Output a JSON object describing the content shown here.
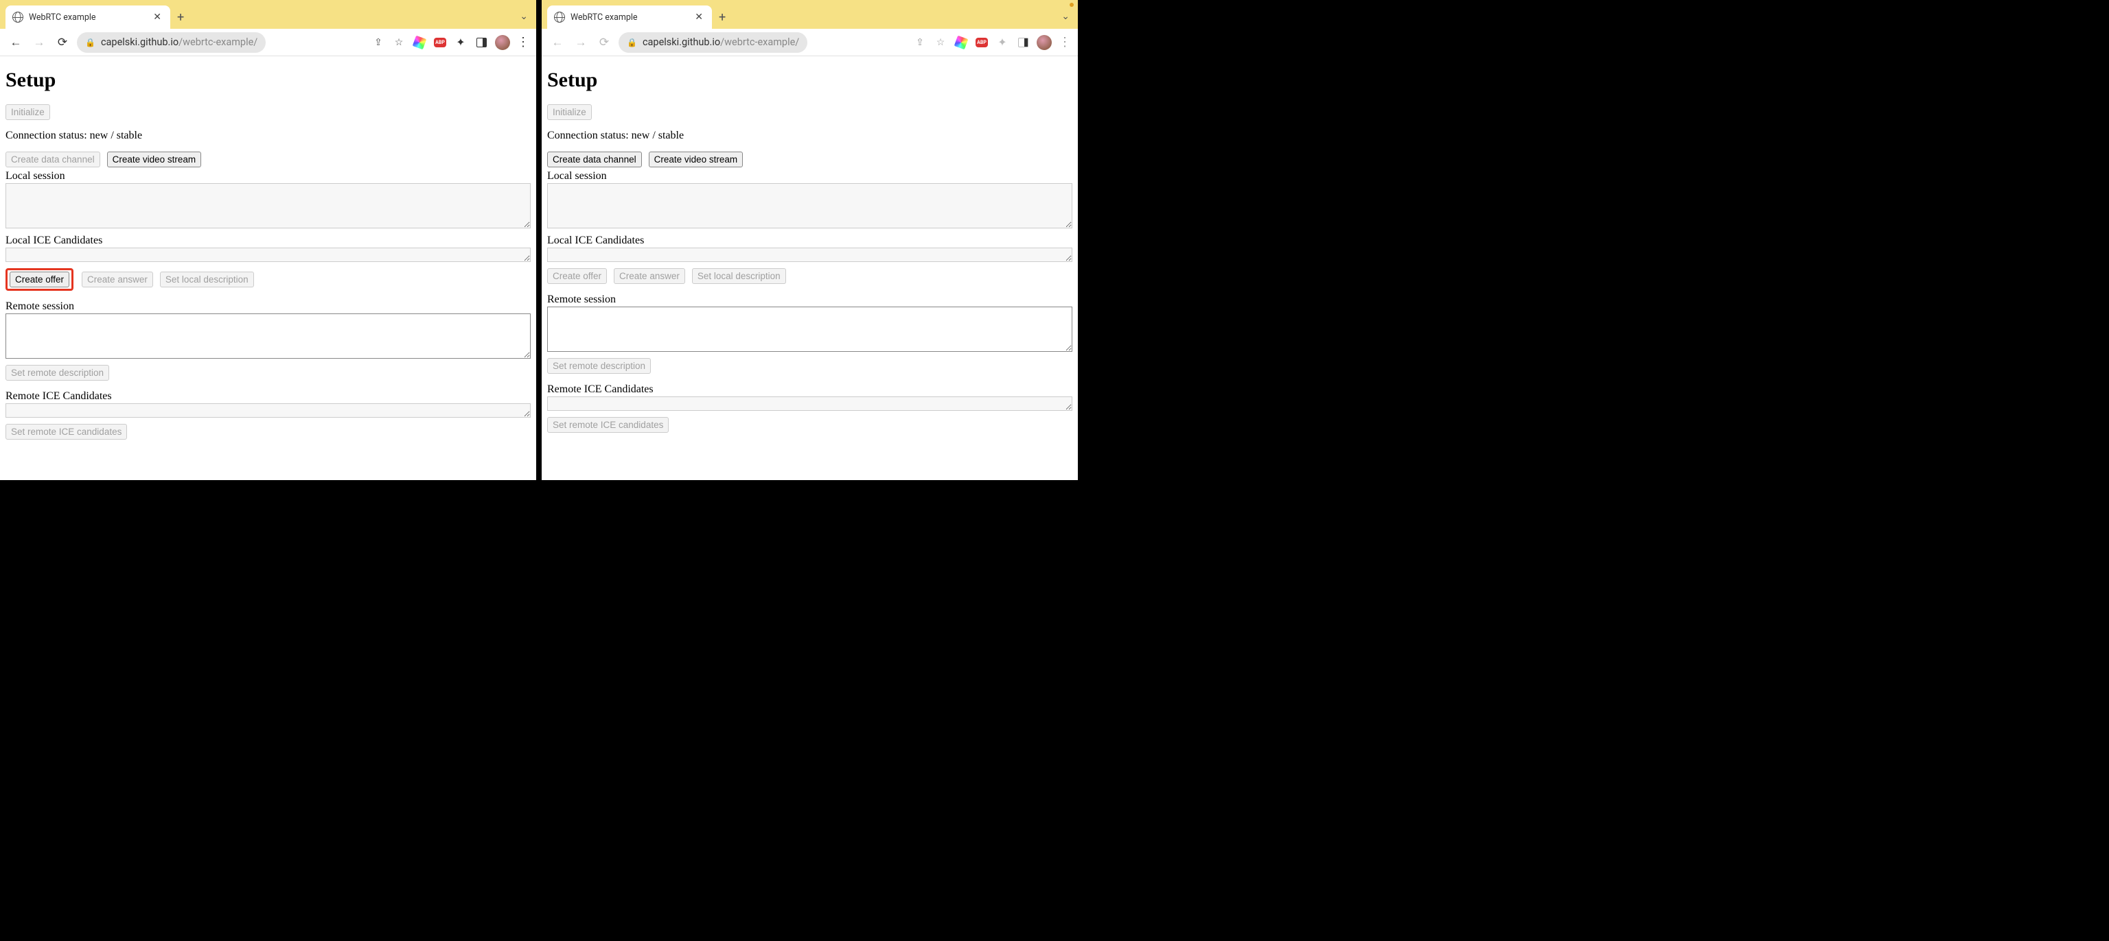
{
  "left": {
    "tab_title": "WebRTC example",
    "url_domain": "capelski.github.io",
    "url_path": "/webrtc-example/",
    "heading": "Setup",
    "buttons": {
      "initialize": "Initialize",
      "create_data_channel": "Create data channel",
      "create_video_stream": "Create video stream",
      "create_offer": "Create offer",
      "create_answer": "Create answer",
      "set_local_description": "Set local description",
      "set_remote_description": "Set remote description",
      "set_remote_ice": "Set remote ICE candidates"
    },
    "labels": {
      "status": "Connection status: new / stable",
      "local_session": "Local session",
      "local_ice": "Local ICE Candidates",
      "remote_session": "Remote session",
      "remote_ice": "Remote ICE Candidates"
    },
    "button_states": {
      "initialize": false,
      "create_data_channel": false,
      "create_video_stream": true,
      "create_offer": true,
      "create_answer": false,
      "set_local_description": false,
      "set_remote_description": false,
      "set_remote_ice": false
    },
    "highlight_create_offer": true
  },
  "right": {
    "tab_title": "WebRTC example",
    "url_domain": "capelski.github.io",
    "url_path": "/webrtc-example/",
    "heading": "Setup",
    "buttons": {
      "initialize": "Initialize",
      "create_data_channel": "Create data channel",
      "create_video_stream": "Create video stream",
      "create_offer": "Create offer",
      "create_answer": "Create answer",
      "set_local_description": "Set local description",
      "set_remote_description": "Set remote description",
      "set_remote_ice": "Set remote ICE candidates"
    },
    "labels": {
      "status": "Connection status: new / stable",
      "local_session": "Local session",
      "local_ice": "Local ICE Candidates",
      "remote_session": "Remote session",
      "remote_ice": "Remote ICE Candidates"
    },
    "button_states": {
      "initialize": false,
      "create_data_channel": true,
      "create_video_stream": true,
      "create_offer": false,
      "create_answer": false,
      "set_local_description": false,
      "set_remote_description": false,
      "set_remote_ice": false
    },
    "highlight_create_offer": false,
    "nav_back_enabled": false,
    "toolbar_icons_disabled": true
  }
}
